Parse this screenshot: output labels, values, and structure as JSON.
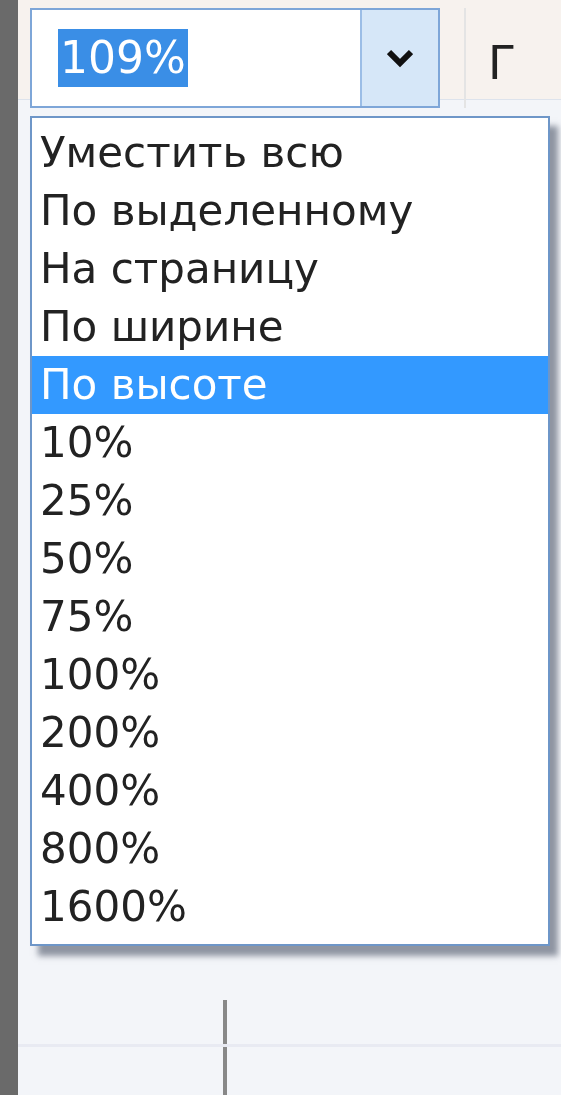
{
  "zoom_combo": {
    "value": "109%",
    "expanded": true
  },
  "toolbar_text": "Г",
  "zoom_options": [
    {
      "label": "Уместить всю",
      "selected": false
    },
    {
      "label": "По выделенному",
      "selected": false
    },
    {
      "label": "На страницу",
      "selected": false
    },
    {
      "label": "По ширине",
      "selected": false
    },
    {
      "label": "По высоте",
      "selected": true
    },
    {
      "label": "10%",
      "selected": false
    },
    {
      "label": "25%",
      "selected": false
    },
    {
      "label": "50%",
      "selected": false
    },
    {
      "label": "75%",
      "selected": false
    },
    {
      "label": "100%",
      "selected": false
    },
    {
      "label": "200%",
      "selected": false
    },
    {
      "label": "400%",
      "selected": false
    },
    {
      "label": "800%",
      "selected": false
    },
    {
      "label": "1600%",
      "selected": false
    }
  ]
}
